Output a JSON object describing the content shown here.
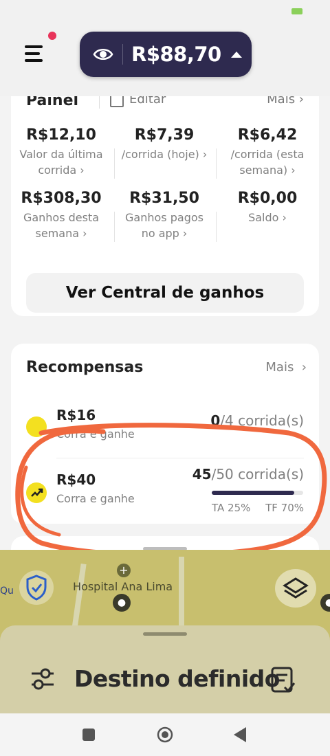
{
  "header": {
    "balance": "R$88,70"
  },
  "painel": {
    "title": "Painel",
    "edit_label": "Editar",
    "more_label": "Mais ›",
    "stats": [
      {
        "value": "R$12,10",
        "label1": "Valor da última",
        "label2": "corrida ›"
      },
      {
        "value": "R$7,39",
        "label1": "/corrida (hoje) ›",
        "label2": ""
      },
      {
        "value": "R$6,42",
        "label1": "/corrida (esta",
        "label2": "semana) ›"
      },
      {
        "value": "R$308,30",
        "label1": "Ganhos desta",
        "label2": "semana ›"
      },
      {
        "value": "R$31,50",
        "label1": "Ganhos pagos",
        "label2": "no app ›"
      },
      {
        "value": "R$0,00",
        "label1": "Saldo ›",
        "label2": ""
      }
    ],
    "central_button": "Ver Central de ganhos"
  },
  "rewards": {
    "title": "Recompensas",
    "more_label": "Mais",
    "items": [
      {
        "amount": "R$16",
        "subtitle": "Corra e ganhe",
        "done": "0",
        "target": "/4 corrida(s)"
      },
      {
        "amount": "R$40",
        "subtitle": "Corra e ganhe",
        "done": "45",
        "target": "/50 corrida(s)",
        "progress": 0.9,
        "ta": "TA 25%",
        "tf": "TF 70%"
      }
    ]
  },
  "map": {
    "place_label": "Hospital Ana Lima",
    "edge_label": "Qu"
  },
  "destination": {
    "label": "Destino definido"
  },
  "colors": {
    "pill": "#2e2a4f",
    "badge": "#e8345a",
    "reward_icon": "#f3e020",
    "annotation": "#f0683e"
  }
}
